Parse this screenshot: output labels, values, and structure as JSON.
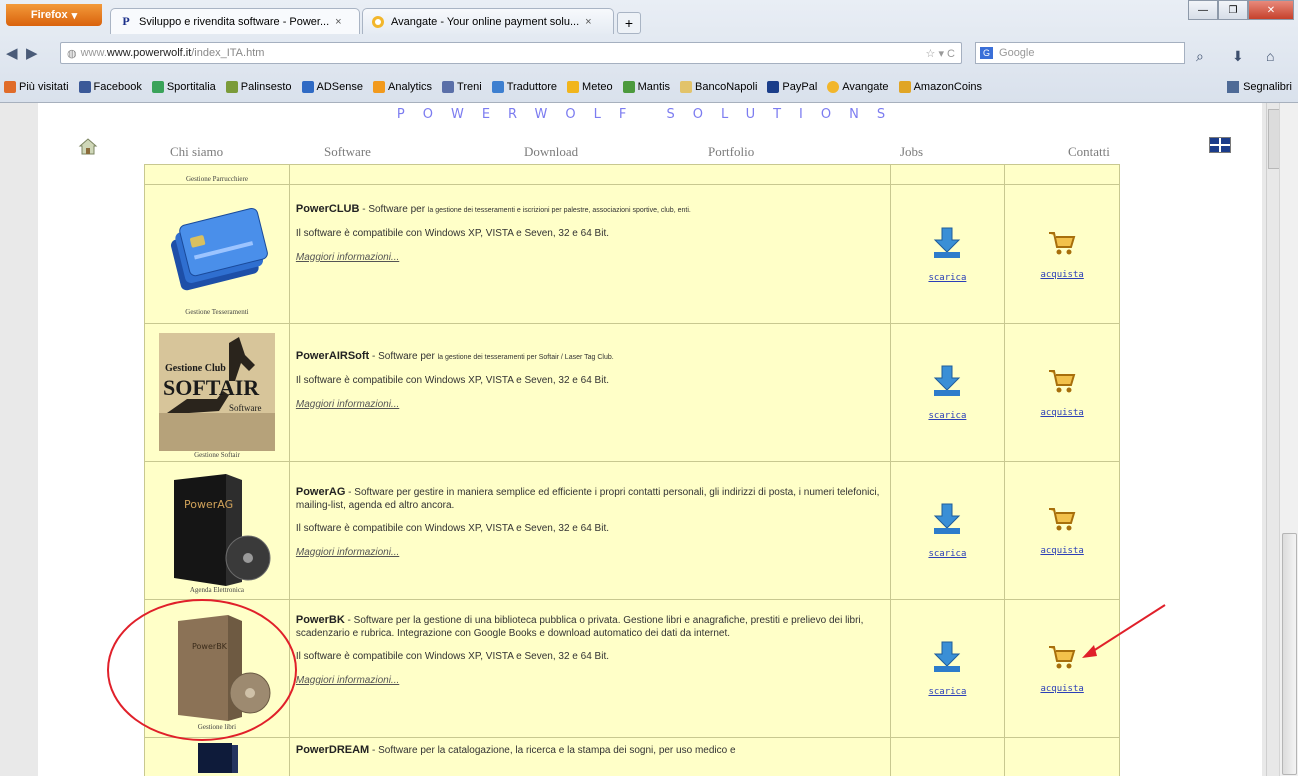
{
  "browser": {
    "app_button": "Firefox",
    "tabs": [
      {
        "title": "Sviluppo e rivendita software - Power...",
        "favicon": "P"
      },
      {
        "title": "Avangate - Your online payment solu...",
        "favicon": "A"
      }
    ],
    "url_domain": "www.powerwolf.it",
    "url_path": "/index_ITA.htm",
    "search_placeholder": "Google",
    "bookmarks": [
      "Più visitati",
      "Facebook",
      "Sportitalia",
      "Palinsesto",
      "ADSense",
      "Analytics",
      "Treni",
      "Traduttore",
      "Meteo",
      "Mantis",
      "BancoNapoli",
      "PayPal",
      "Avangate",
      "AmazonCoins"
    ],
    "bookmarks_menu": "Segnalibri"
  },
  "site": {
    "brand": "POWERWOLF SOLUTIONS",
    "menu": [
      "Chi siamo",
      "Software",
      "Download",
      "Portfolio",
      "Jobs",
      "Contatti"
    ],
    "top_caption": "Gestione Parrucchiere"
  },
  "products": [
    {
      "name": "PowerCLUB",
      "lead": " - Software per ",
      "desc": "la gestione dei tesseramenti e iscrizioni per palestre, associazioni sportive, club, enti.",
      "compat": "Il software è compatibile con Windows XP, VISTA e Seven, 32 e 64 Bit.",
      "more": "Maggiori informazioni...",
      "caption": "Gestione Tesseramenti",
      "download": "scarica",
      "buy": "acquista"
    },
    {
      "name": "PowerAIRSoft",
      "lead": " - Software per ",
      "desc": "la gestione dei tesseramenti per Softair / Laser Tag Club.",
      "compat": "Il software è compatibile con Windows XP, VISTA e Seven, 32 e 64 Bit.",
      "more": "Maggiori informazioni...",
      "caption": "Gestione Softair",
      "box_text": [
        "Gestione Club",
        "SOFTAIR",
        "Software"
      ],
      "download": "scarica",
      "buy": "acquista"
    },
    {
      "name": "PowerAG",
      "lead": " - Software per gestire in maniera semplice ed efficiente i propri contatti personali, gli indirizzi di posta, i numeri telefonici, mailing-list, agenda ed altro ancora.",
      "desc": "",
      "compat": "Il software è compatibile con Windows XP, VISTA e Seven, 32 e 64 Bit.",
      "more": "Maggiori informazioni...",
      "caption": "Agenda Elettronica",
      "box_text": [
        "PowerAG"
      ],
      "download": "scarica",
      "buy": "acquista"
    },
    {
      "name": "PowerBK",
      "lead": " - Software per la gestione di una biblioteca pubblica o privata. Gestione libri e anagrafiche, prestiti e prelievo dei libri, scadenzario e rubrica. Integrazione con Google Books e download automatico dei dati da internet.",
      "desc": "",
      "compat": "Il software è compatibile con Windows XP, VISTA e Seven, 32 e 64 Bit.",
      "more": "Maggiori informazioni...",
      "caption": "Gestione libri",
      "box_text": [
        "PowerBK"
      ],
      "download": "scarica",
      "buy": "acquista"
    },
    {
      "name": "PowerDREAM",
      "lead": " - Software per la catalogazione, la ricerca e la stampa dei sogni, per uso medico e",
      "desc": "",
      "compat": "",
      "more": "",
      "caption": "",
      "download": "",
      "buy": ""
    }
  ],
  "colors": {
    "table_bg": "#ffffc8",
    "brand_text": "#7c7cf0",
    "annotation": "#e0202a",
    "link": "#2b3fb8"
  }
}
